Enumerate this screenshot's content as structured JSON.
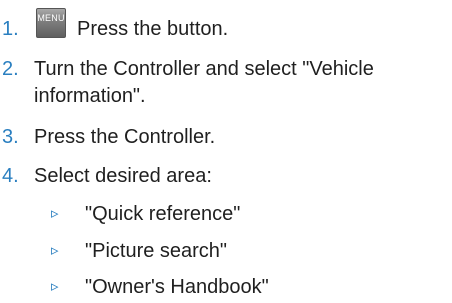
{
  "steps": [
    {
      "number": "1.",
      "button_label": "MENU",
      "text": "Press the button."
    },
    {
      "number": "2.",
      "text_line1": "Turn the Controller and select \"Vehicle",
      "text_line2": "information\"."
    },
    {
      "number": "3.",
      "text": "Press the Controller."
    },
    {
      "number": "4.",
      "text": "Select desired area:"
    }
  ],
  "options": [
    {
      "marker": "▹",
      "label": "\"Quick reference\""
    },
    {
      "marker": "▹",
      "label": "\"Picture search\""
    },
    {
      "marker": "▹",
      "label": "\"Owner's Handbook\""
    }
  ],
  "colors": {
    "numbers": "#2a7fc0",
    "text": "#1f1f1f",
    "menu_button": "#7a7a7a"
  },
  "icons": {
    "menu_key": "menu-key-icon",
    "option_marker": "triangle-right-icon"
  }
}
